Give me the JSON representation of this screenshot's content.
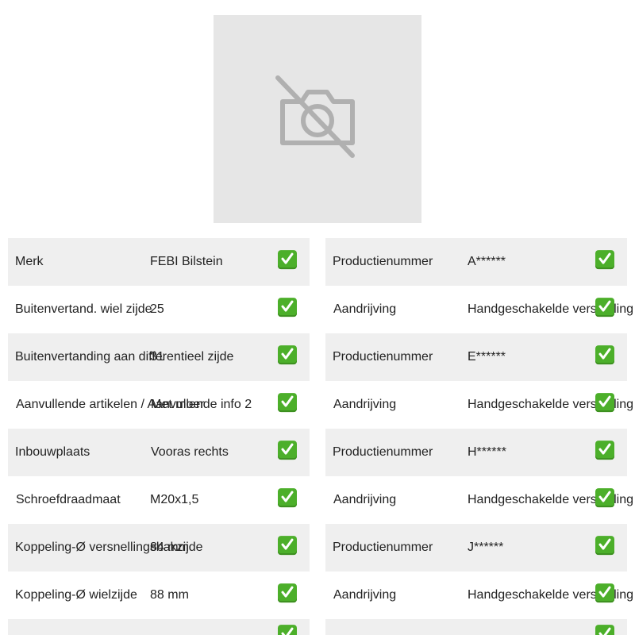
{
  "image": {
    "icon": "no-camera-icon",
    "background": "#e6e6e6",
    "icon_color": "#b0b0b0"
  },
  "colors": {
    "row_shaded": "#efefef",
    "check_green": "#4caf2a"
  },
  "left_table": [
    {
      "label": "Merk",
      "value": "FEBI Bilstein"
    },
    {
      "label": "Buitenvertand. wiel zijde",
      "value": "25"
    },
    {
      "label": "Buitenvertanding aan differentieel zijde",
      "value": "31"
    },
    {
      "label": "Aanvullende artikelen / Aanvullende info 2",
      "value": "Met moer"
    },
    {
      "label": "Inbouwplaats",
      "value": "Vooras rechts"
    },
    {
      "label": "Schroefdraadmaat",
      "value": "M20x1,5"
    },
    {
      "label": "Koppeling-Ø versnellingsbakzijde",
      "value": "84 mm"
    },
    {
      "label": "Koppeling-Ø wielzijde",
      "value": "88 mm"
    }
  ],
  "right_table": [
    {
      "label": "Productienummer",
      "value": "A******"
    },
    {
      "label": "Aandrijving",
      "value": "Handgeschakelde versnelling"
    },
    {
      "label": "Productienummer",
      "value": "E******"
    },
    {
      "label": "Aandrijving",
      "value": "Handgeschakelde versnelling"
    },
    {
      "label": "Productienummer",
      "value": "H******"
    },
    {
      "label": "Aandrijving",
      "value": "Handgeschakelde versnelling"
    },
    {
      "label": "Productienummer",
      "value": "J******"
    },
    {
      "label": "Aandrijving",
      "value": "Handgeschakelde versnelling"
    }
  ]
}
